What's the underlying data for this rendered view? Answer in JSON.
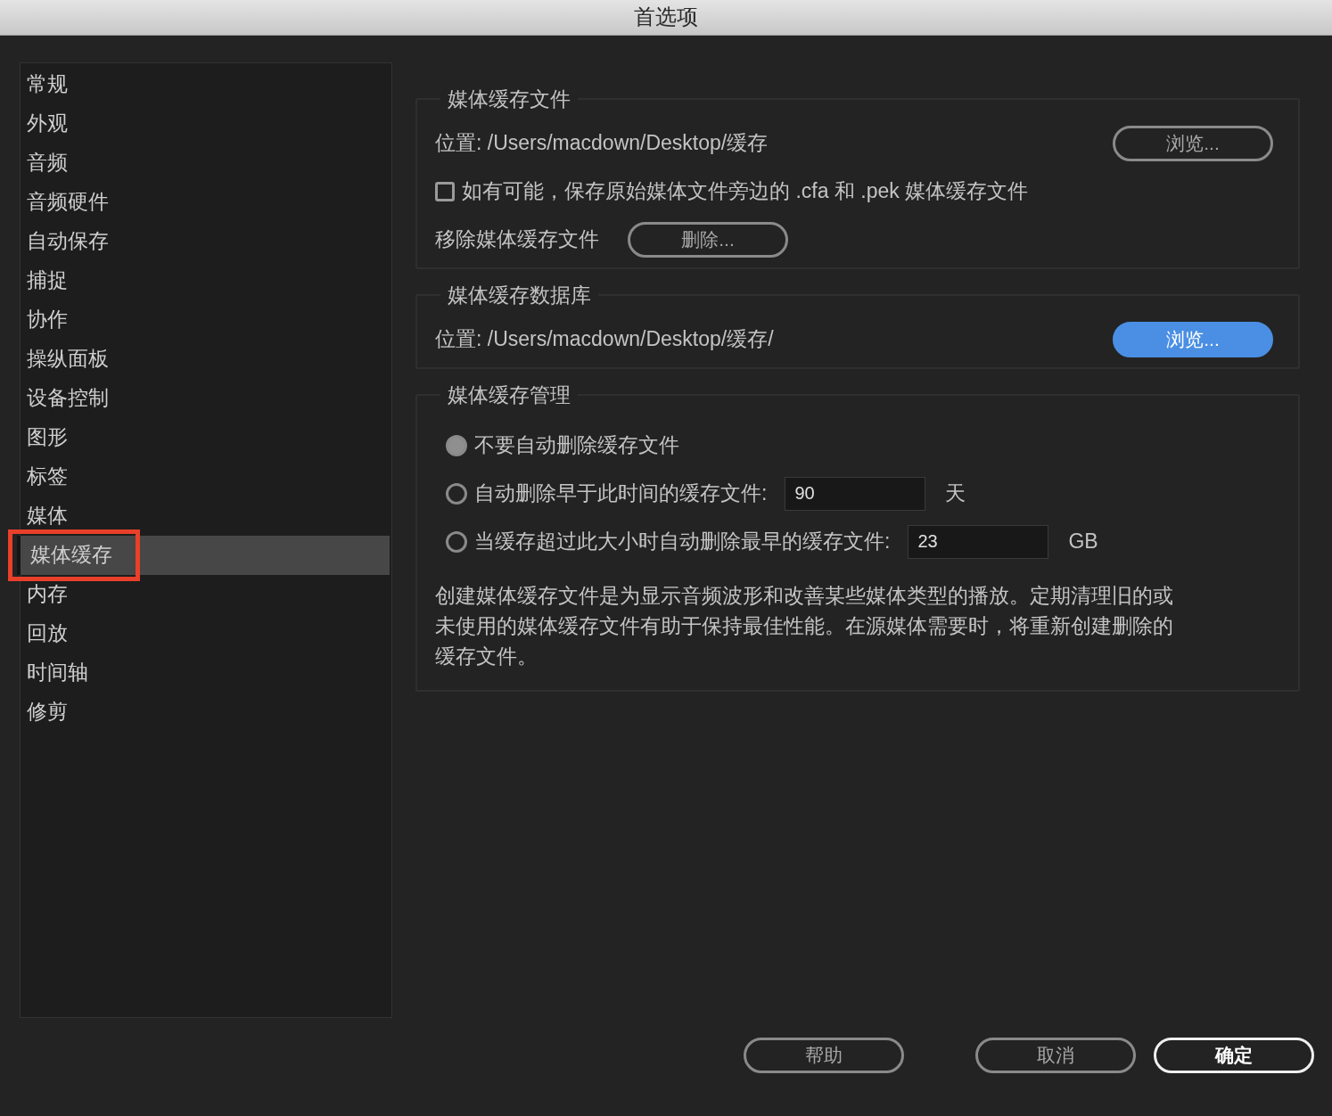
{
  "window": {
    "title": "首选项"
  },
  "sidebar": {
    "items": [
      {
        "label": "常规",
        "selected": false,
        "highlighted": false
      },
      {
        "label": "外观",
        "selected": false,
        "highlighted": false
      },
      {
        "label": "音频",
        "selected": false,
        "highlighted": false
      },
      {
        "label": "音频硬件",
        "selected": false,
        "highlighted": false
      },
      {
        "label": "自动保存",
        "selected": false,
        "highlighted": false
      },
      {
        "label": "捕捉",
        "selected": false,
        "highlighted": false
      },
      {
        "label": "协作",
        "selected": false,
        "highlighted": false
      },
      {
        "label": "操纵面板",
        "selected": false,
        "highlighted": false
      },
      {
        "label": "设备控制",
        "selected": false,
        "highlighted": false
      },
      {
        "label": "图形",
        "selected": false,
        "highlighted": false
      },
      {
        "label": "标签",
        "selected": false,
        "highlighted": false
      },
      {
        "label": "媒体",
        "selected": false,
        "highlighted": false
      },
      {
        "label": "媒体缓存",
        "selected": true,
        "highlighted": true
      },
      {
        "label": "内存",
        "selected": false,
        "highlighted": false
      },
      {
        "label": "回放",
        "selected": false,
        "highlighted": false
      },
      {
        "label": "时间轴",
        "selected": false,
        "highlighted": false
      },
      {
        "label": "修剪",
        "selected": false,
        "highlighted": false
      }
    ]
  },
  "media_cache_files": {
    "title": "媒体缓存文件",
    "location": "位置: /Users/macdown/Desktop/缓存",
    "browse_button": {
      "label": "浏览...",
      "kind": "outline"
    },
    "checkbox": {
      "label": "如有可能，保存原始媒体文件旁边的 .cfa 和 .pek 媒体缓存文件",
      "checked": false
    },
    "remove_label": "移除媒体缓存文件",
    "delete_button": {
      "label": "删除...",
      "kind": "outline"
    }
  },
  "media_cache_database": {
    "title": "媒体缓存数据库",
    "location": "位置: /Users/macdown/Desktop/缓存/",
    "browse_button": {
      "label": "浏览...",
      "kind": "primary"
    }
  },
  "media_cache_management": {
    "title": "媒体缓存管理",
    "options": [
      {
        "label": "不要自动删除缓存文件",
        "selected": true
      },
      {
        "label": "自动删除早于此时间的缓存文件:",
        "selected": false,
        "value": "90",
        "unit": "天"
      },
      {
        "label": "当缓存超过此大小时自动删除最早的缓存文件:",
        "selected": false,
        "value": "23",
        "unit": "GB"
      }
    ],
    "description": "创建媒体缓存文件是为显示音频波形和改善某些媒体类型的播放。定期清理旧的或未使用的媒体缓存文件有助于保持最佳性能。在源媒体需要时，将重新创建删除的缓存文件。"
  },
  "footer": {
    "buttons": [
      {
        "label": "帮助",
        "kind": "outline"
      },
      {
        "label": "取消",
        "kind": "outline"
      },
      {
        "label": "确定",
        "kind": "default"
      }
    ]
  }
}
